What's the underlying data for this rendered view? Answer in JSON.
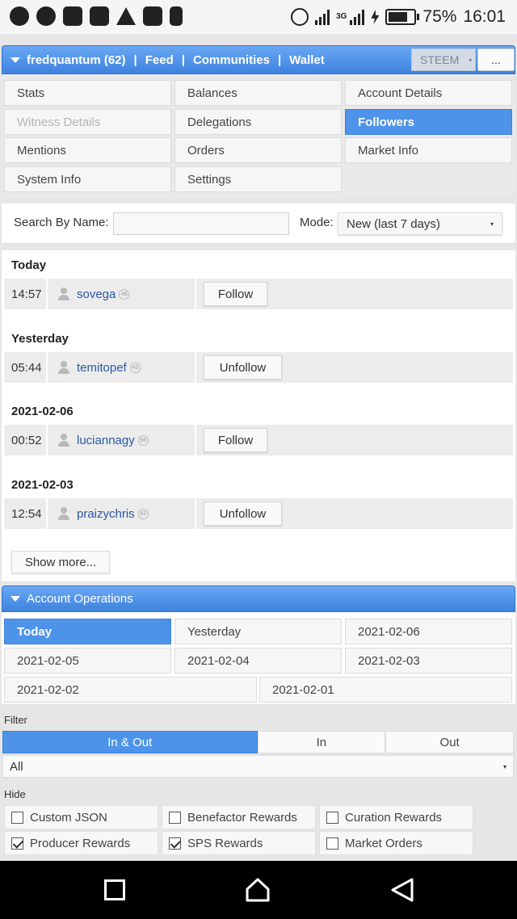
{
  "status_bar": {
    "battery": "75%",
    "time": "16:01",
    "network": "3G",
    "icons": [
      "whatsapp-icon",
      "compass-icon",
      "message-icon",
      "gmail-icon",
      "warning-icon",
      "image-icon",
      "download-icon",
      "alarm-icon",
      "signal-icon",
      "charging-icon",
      "battery-icon"
    ]
  },
  "topbar": {
    "user": "fredquantum (62)",
    "sep": "|",
    "links": [
      "Feed",
      "Communities",
      "Wallet"
    ],
    "chain": "STEEM",
    "more": "..."
  },
  "tabs": [
    "Stats",
    "Balances",
    "Account Details",
    "Witness Details",
    "Delegations",
    "Followers",
    "Mentions",
    "Orders",
    "Market Info",
    "System Info",
    "Settings"
  ],
  "active_tab": "Followers",
  "search": {
    "label": "Search By Name:",
    "value": "",
    "mode_label": "Mode:",
    "mode_value": "New (last 7 days)"
  },
  "followers": [
    {
      "day": "Today",
      "time": "14:57",
      "user": "sovega",
      "rep": "46",
      "action": "Follow"
    },
    {
      "day": "Yesterday",
      "time": "05:44",
      "user": "temitopef",
      "rep": "45",
      "action": "Unfollow"
    },
    {
      "day": "2021-02-06",
      "time": "00:52",
      "user": "luciannagy",
      "rep": "66",
      "action": "Follow"
    },
    {
      "day": "2021-02-03",
      "time": "12:54",
      "user": "praizychris",
      "rep": "43",
      "action": "Unfollow"
    }
  ],
  "show_more": "Show more...",
  "account_operations": {
    "title": "Account Operations",
    "days": [
      "Today",
      "Yesterday",
      "2021-02-06",
      "2021-02-05",
      "2021-02-04",
      "2021-02-03",
      "2021-02-02",
      "2021-02-01"
    ],
    "active_day": "Today",
    "filter_label": "Filter",
    "filter_segments": [
      "In & Out",
      "In",
      "Out"
    ],
    "filter_type": "All",
    "hide_label": "Hide",
    "hide_options": [
      {
        "label": "Custom JSON",
        "checked": false
      },
      {
        "label": "Benefactor Rewards",
        "checked": false
      },
      {
        "label": "Curation Rewards",
        "checked": false
      },
      {
        "label": "Producer Rewards",
        "checked": true
      },
      {
        "label": "SPS Rewards",
        "checked": true
      },
      {
        "label": "Market Orders",
        "checked": false
      }
    ]
  },
  "colors": {
    "accent": "#4d93ea",
    "header_gradient_top": "#6aa8f3",
    "link": "#2959a8"
  }
}
